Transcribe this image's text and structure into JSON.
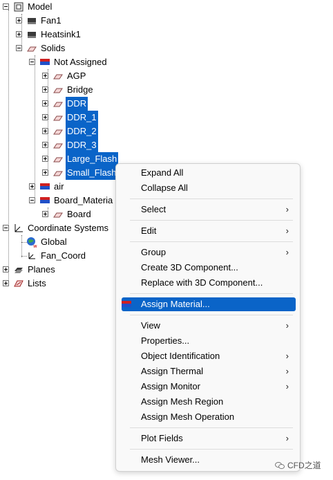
{
  "tree": {
    "model": "Model",
    "fan1": "Fan1",
    "heatsink1": "Heatsink1",
    "solids": "Solids",
    "not_assigned": "Not Assigned",
    "items": [
      "AGP",
      "Bridge",
      "DDR",
      "DDR_1",
      "DDR_2",
      "DDR_3",
      "Large_Flash",
      "Small_Flash"
    ],
    "air": "air",
    "board_material": "Board_Materia",
    "board": "Board",
    "coordinate_systems": "Coordinate Systems",
    "global": "Global",
    "fan_coord": "Fan_Coord",
    "planes": "Planes",
    "lists": "Lists"
  },
  "menu": {
    "expand_all": "Expand All",
    "collapse_all": "Collapse All",
    "select": "Select",
    "edit": "Edit",
    "group": "Group",
    "create_3d": "Create 3D Component...",
    "replace_3d": "Replace with 3D Component...",
    "assign_material": "Assign Material...",
    "view": "View",
    "properties": "Properties...",
    "object_identification": "Object Identification",
    "assign_thermal": "Assign Thermal",
    "assign_monitor": "Assign Monitor",
    "assign_mesh_region": "Assign Mesh Region",
    "assign_mesh_operation": "Assign Mesh Operation",
    "plot_fields": "Plot Fields",
    "mesh_viewer": "Mesh Viewer...",
    "submenu_arrow": "›"
  },
  "watermark": "CFD之道",
  "colors": {
    "selection": "#0a64c8"
  }
}
